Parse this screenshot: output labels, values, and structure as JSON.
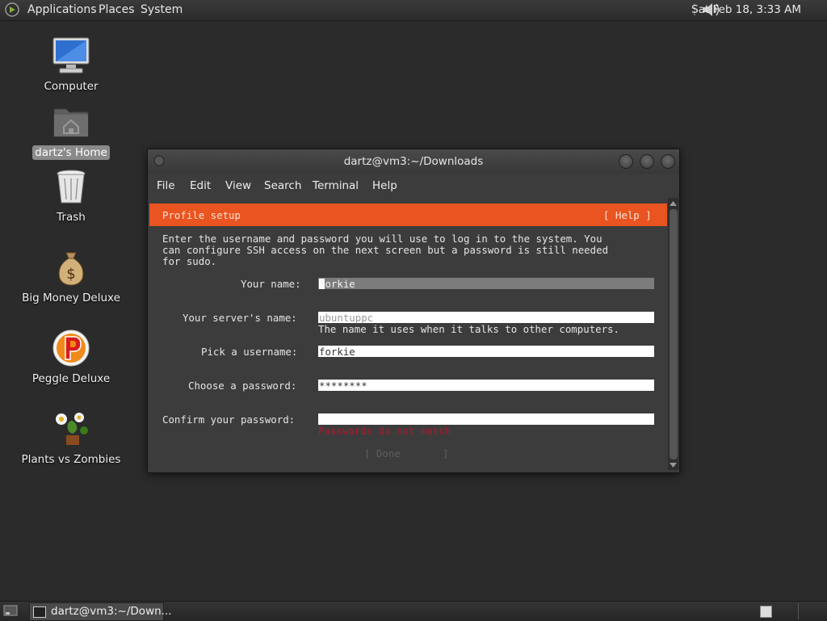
{
  "top_panel": {
    "menus": [
      "Applications",
      "Places",
      "System"
    ],
    "clock": "Sat Feb 18,  3:33 AM"
  },
  "desktop": {
    "icons": [
      {
        "label": "Computer",
        "icon": "computer-icon"
      },
      {
        "label": "dartz's Home",
        "icon": "home-folder-icon",
        "selected": true
      },
      {
        "label": "Trash",
        "icon": "trash-icon"
      },
      {
        "label": "Big Money Deluxe",
        "icon": "money-bag-icon"
      },
      {
        "label": "Peggle Deluxe",
        "icon": "peggle-icon"
      },
      {
        "label": "Plants vs Zombies",
        "icon": "plants-icon"
      }
    ]
  },
  "window": {
    "title": "dartz@vm3:~/Downloads",
    "menu": [
      "File",
      "Edit",
      "View",
      "Search",
      "Terminal",
      "Help"
    ]
  },
  "installer": {
    "header": "Profile setup",
    "help": "[ Help ]",
    "intro": [
      "Enter the username and password you will use to log in to the system. You",
      "can configure SSH access on the next screen but a password is still needed",
      "for sudo."
    ],
    "fields": {
      "name": {
        "label": "Your name:",
        "value": "forkie"
      },
      "server": {
        "label": "Your server's name:",
        "placeholder": "ubuntuppc",
        "hint": "The name it uses when it talks to other computers."
      },
      "username": {
        "label": "Pick a username:",
        "value": "forkie"
      },
      "password": {
        "label": "Choose a password:",
        "value": "********"
      },
      "confirm": {
        "label": "Confirm your password:",
        "value": "",
        "error": "Passwords do not match"
      }
    },
    "done": "[ Done       ]"
  },
  "taskbar": {
    "task_label": "dartz@vm3:~/Down..."
  },
  "colors": {
    "accent": "#e95420",
    "error": "#c7162b"
  }
}
